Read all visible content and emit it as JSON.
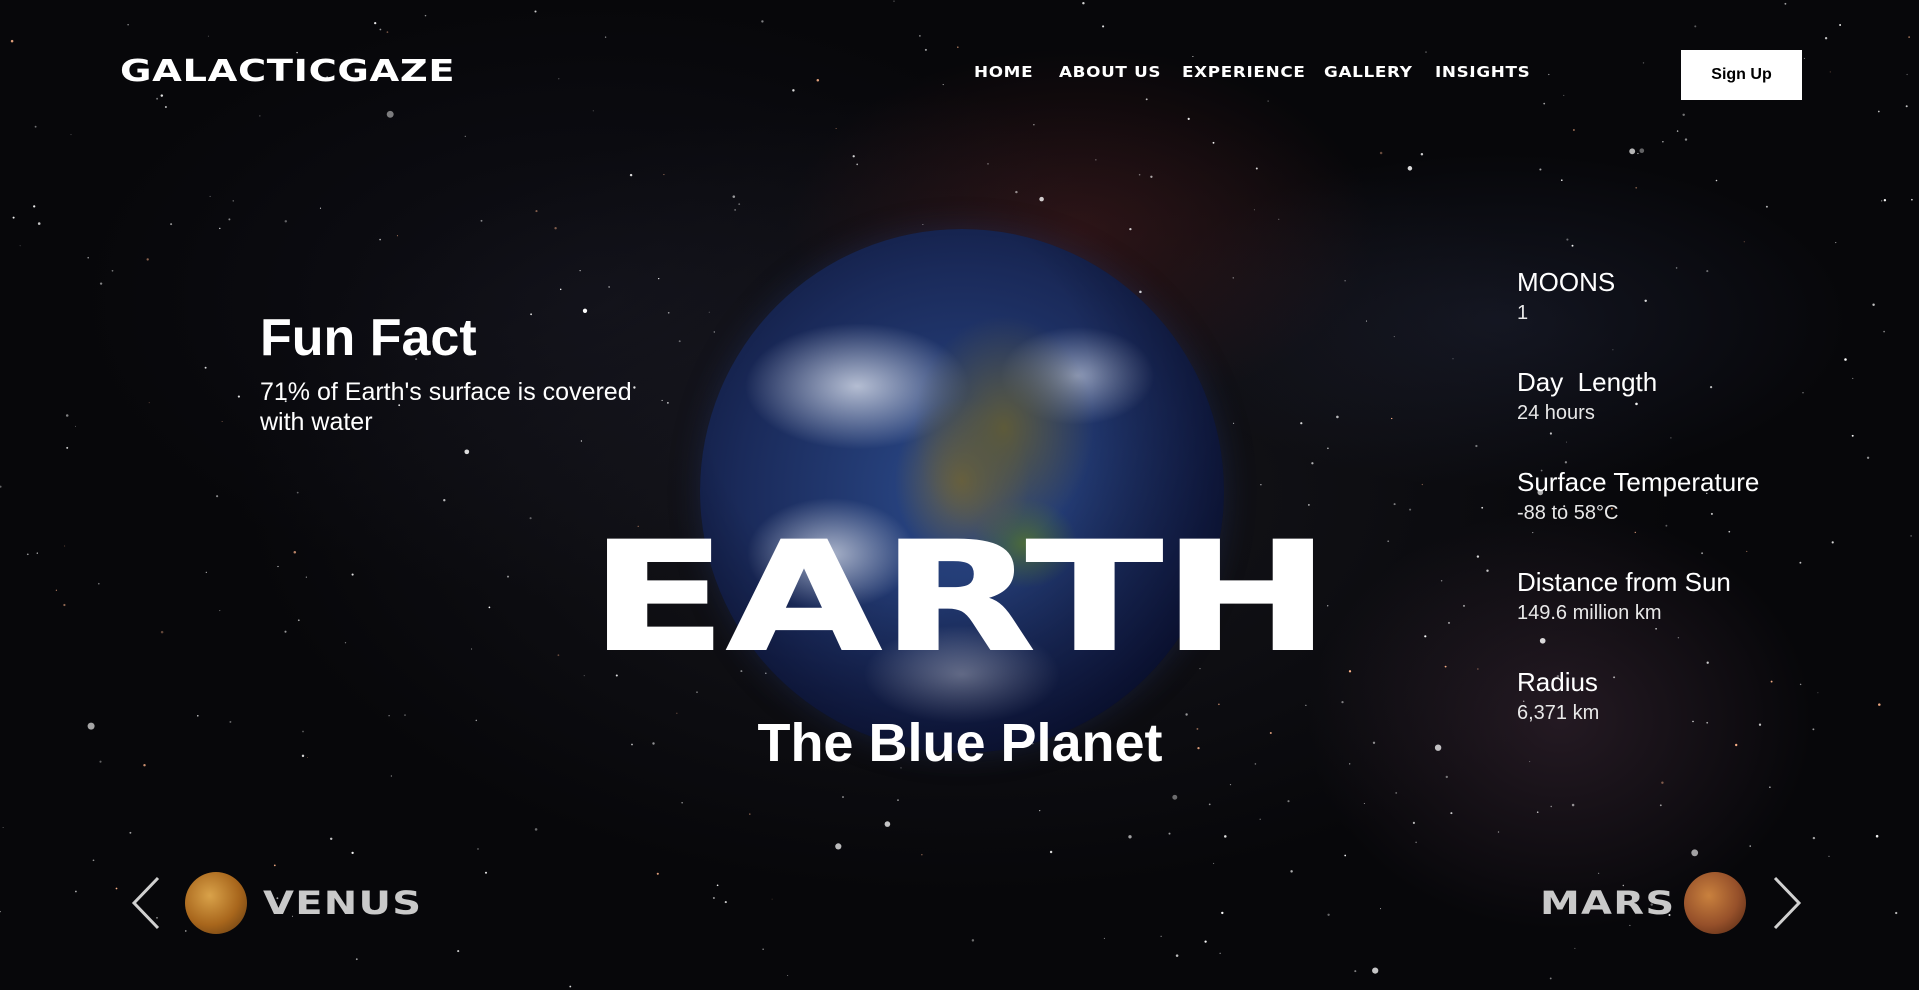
{
  "brand": {
    "name": "GALACTICGAZE"
  },
  "nav": {
    "items": [
      "HOME",
      "ABOUT US",
      "EXPERIENCE",
      "GALLERY",
      "INSIGHTS"
    ],
    "signup_label": "Sign Up"
  },
  "hero": {
    "planet_name": "EARTH",
    "tagline": "The Blue Planet",
    "fun_fact": {
      "title": "Fun Fact",
      "text": "71% of Earth's surface is covered with water"
    }
  },
  "stats": [
    {
      "label": "MOONS",
      "value": "1"
    },
    {
      "label": "Day  Length",
      "value": "24 hours"
    },
    {
      "label": "Surface Temperature",
      "value": "-88 to 58°C"
    },
    {
      "label": "Distance from Sun",
      "value": "149.6 million km"
    },
    {
      "label": "Radius",
      "value": "6,371 km"
    }
  ],
  "pager": {
    "prev": {
      "name": "VENUS",
      "icon": "chevron-left-icon"
    },
    "next": {
      "name": "MARS",
      "icon": "chevron-right-icon"
    }
  }
}
